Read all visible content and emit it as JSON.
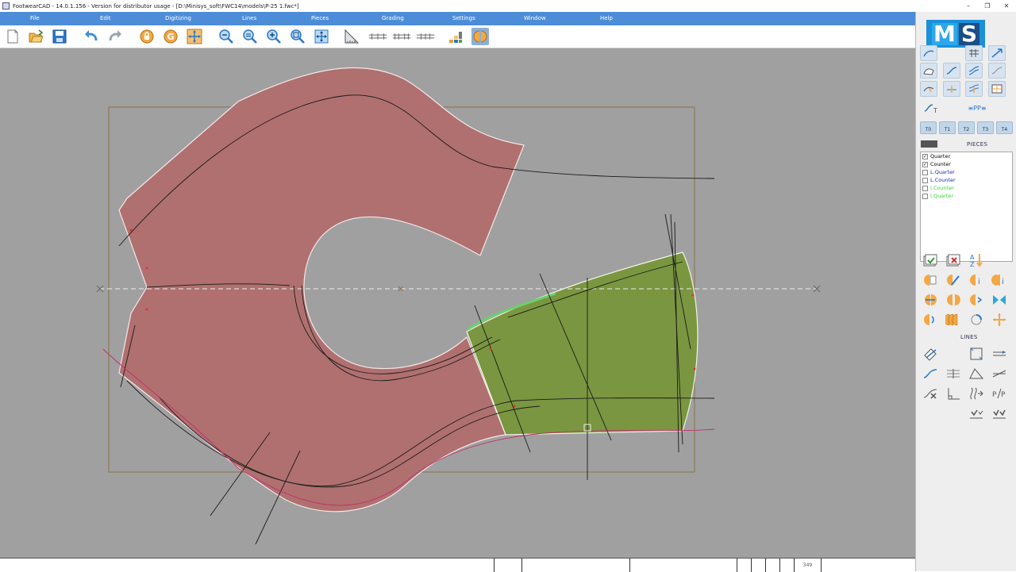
{
  "window": {
    "title": "FootwearCAD - 14.0.1.156 - Version for distributor usage - [D:\\Minisys_soft\\FWC14\\models\\P-25  1.fwc*]",
    "controls": [
      "–",
      "❐",
      "✕"
    ]
  },
  "menu": {
    "file": "File",
    "edit": "Edit",
    "digitizing": "Digitizing",
    "lines": "Lines",
    "pieces": "Pieces",
    "grading": "Grading",
    "settings": "Settings",
    "window": "Window",
    "help": "Help"
  },
  "toolbar": {
    "items": [
      "new-icon",
      "open-icon",
      "save-icon",
      "undo-icon",
      "redo-icon",
      "lock-icon",
      "g-icon",
      "move-icon",
      "zoom-out-icon",
      "zoom-out-2-icon",
      "zoom-in-icon",
      "zoom-window-icon",
      "zoom-fit-icon",
      "ruler-icon",
      "spacing-1-icon",
      "spacing-2-icon",
      "spacing-3-icon",
      "layers-icon",
      "pieces-toggle-icon"
    ]
  },
  "side_panel": {
    "logo_left": "M",
    "logo_right": "S",
    "grade_buttons": [
      "T0",
      "T1",
      "T2",
      "T3",
      "T4"
    ],
    "extra_label": "≡PP≡",
    "pieces_section_label": "PIECES",
    "pieces": [
      {
        "name": "Quarter",
        "checked": true,
        "color": "#000000"
      },
      {
        "name": "Counter",
        "checked": true,
        "color": "#000000"
      },
      {
        "name": "L.Quarter",
        "checked": false,
        "color": "#1a2fa0"
      },
      {
        "name": "L.Counter",
        "checked": false,
        "color": "#1a2fa0"
      },
      {
        "name": "I.Counter",
        "checked": false,
        "color": "#39d339"
      },
      {
        "name": "I.Quarter",
        "checked": false,
        "color": "#39d339"
      }
    ],
    "lines_section_label": "LINES"
  },
  "status_bar": {
    "value": "349"
  },
  "colors": {
    "menu_bg": "#4d8dd8",
    "canvas_bg": "#a0a0a0",
    "quarter_fill": "#b07070",
    "counter_fill": "#7a9640",
    "accent_orange": "#f0a040"
  }
}
